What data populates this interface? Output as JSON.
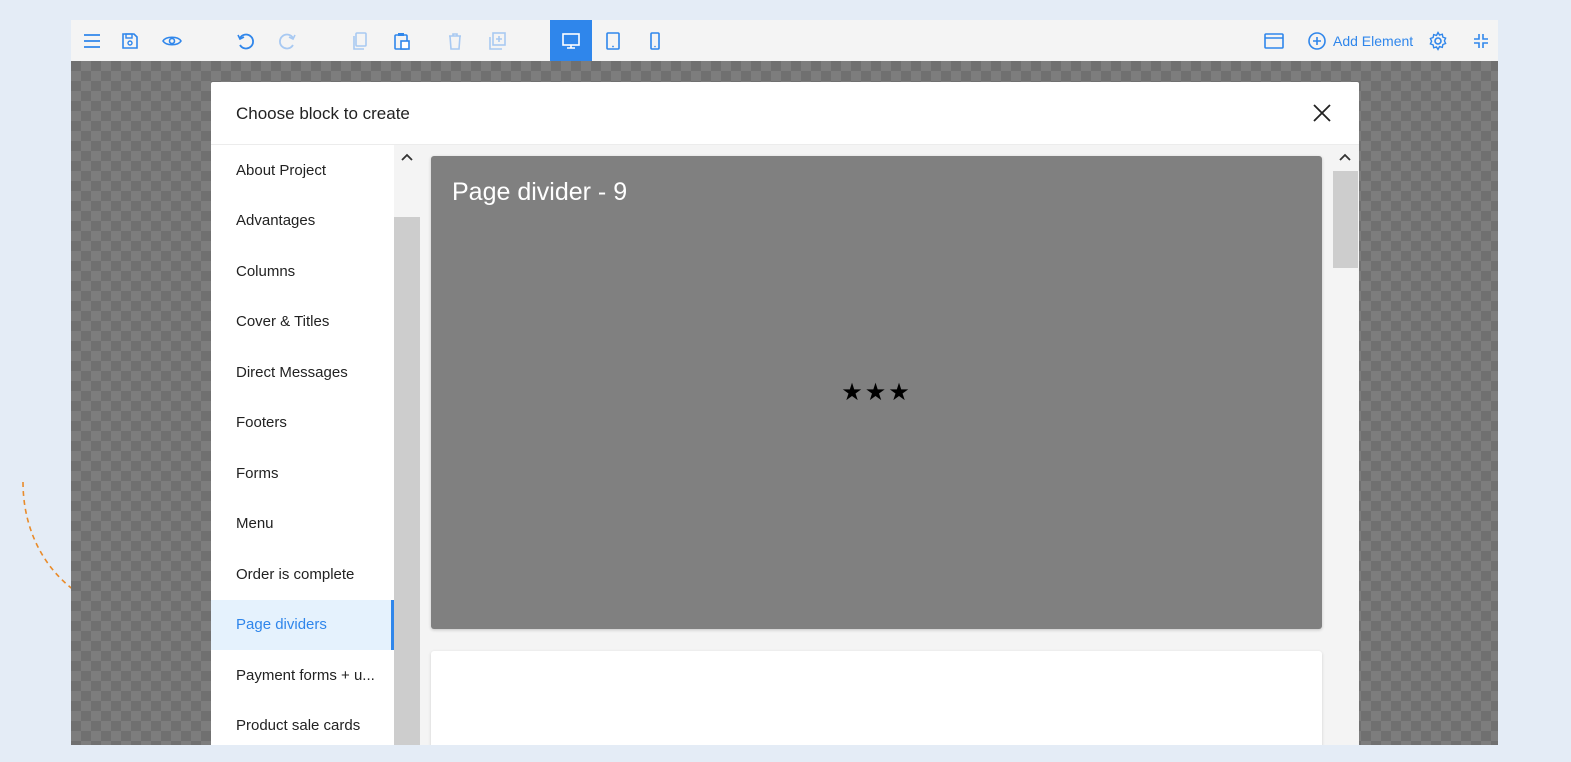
{
  "colors": {
    "accent": "#2f86eb",
    "page_bg": "#e4ecf6",
    "preview_card": "#808080",
    "decor_arrow": "#e98b2a"
  },
  "toolbar": {
    "icons_left": [
      "menu-icon",
      "save-icon",
      "preview-eye-icon",
      "undo-icon",
      "redo-icon",
      "copy-icon",
      "paste-icon",
      "delete-icon",
      "duplicate-icon"
    ],
    "devices": [
      "desktop-icon",
      "tablet-icon",
      "mobile-icon"
    ],
    "active_device": "desktop",
    "add_element_label": "Add Element",
    "icons_right": [
      "window-icon",
      "add-circle-icon",
      "settings-gear-icon",
      "collapse-icon"
    ]
  },
  "modal": {
    "title": "Choose block to create",
    "categories": [
      "About Project",
      "Advantages",
      "Columns",
      "Cover & Titles",
      "Direct Messages",
      "Footers",
      "Forms",
      "Menu",
      "Order is complete",
      "Page dividers",
      "Payment forms + u...",
      "Product sale cards"
    ],
    "active_category": "Page dividers",
    "preview": {
      "card_title": "Page divider - 9",
      "card_content": "★★★"
    }
  }
}
